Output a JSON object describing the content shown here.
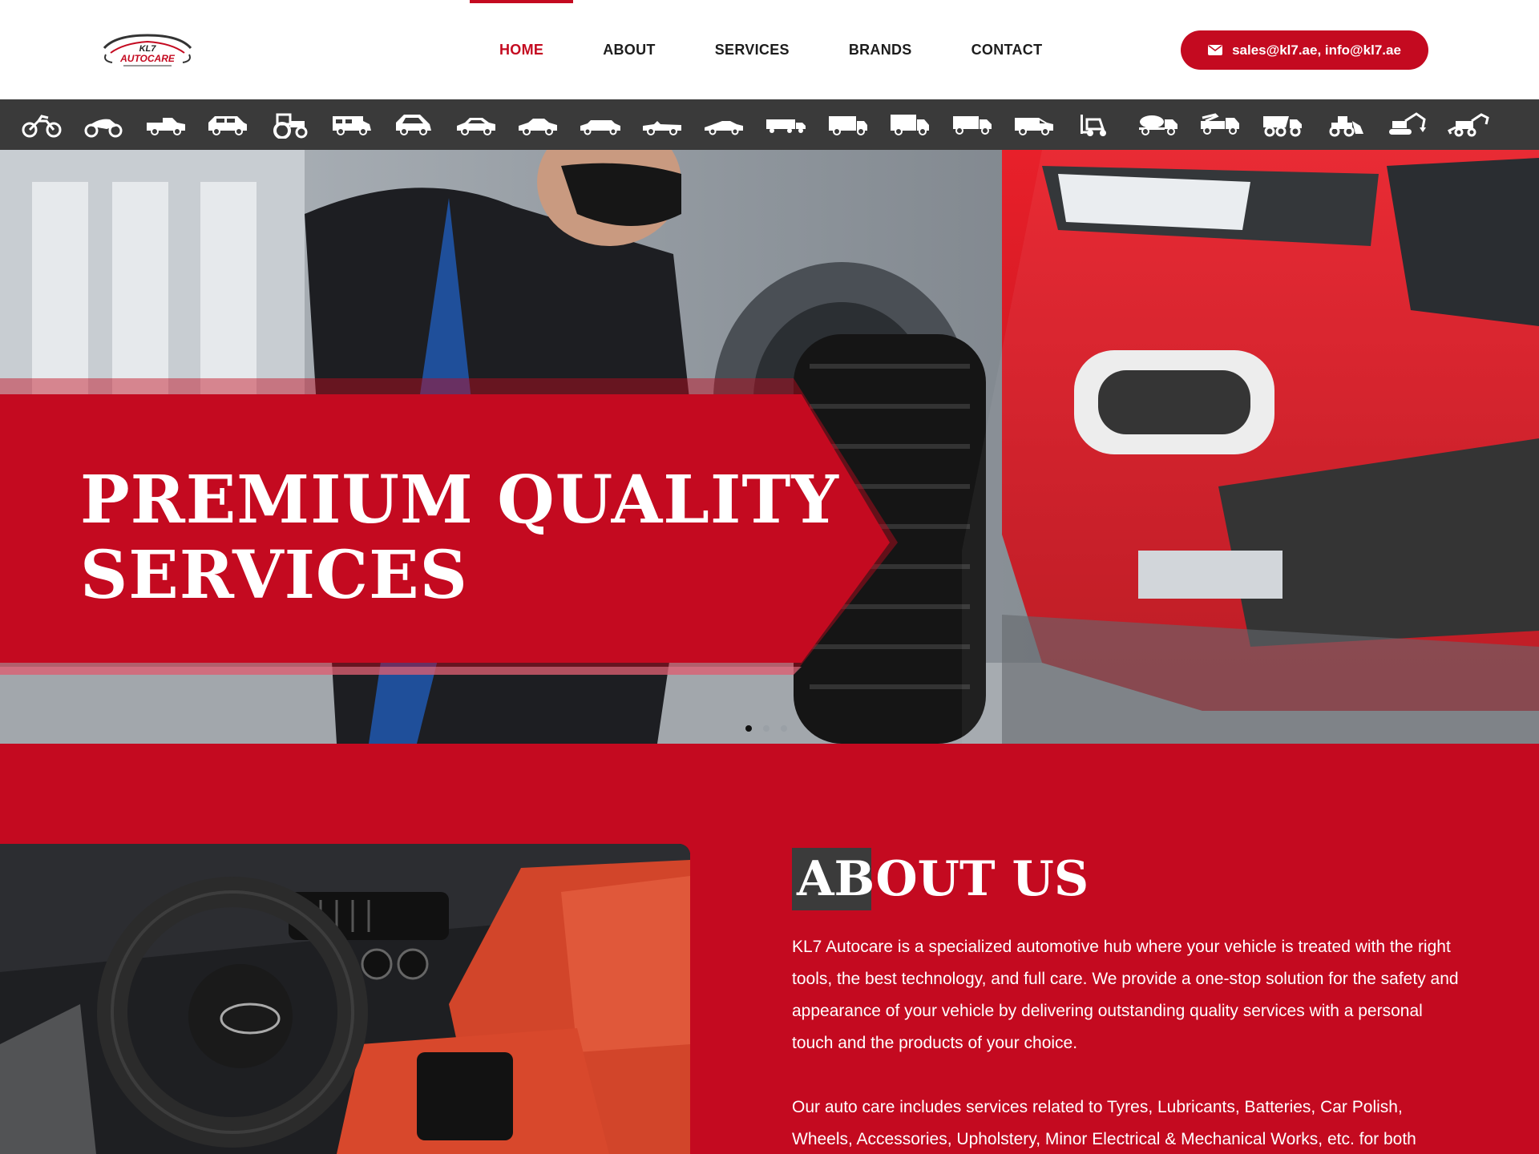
{
  "header": {
    "logo_alt": "KL7 Autocare",
    "logo_top": "KL7",
    "logo_main": "AUTOCARE",
    "nav": [
      {
        "label": "HOME",
        "active": true
      },
      {
        "label": "ABOUT",
        "active": false
      },
      {
        "label": "SERVICES",
        "active": false
      },
      {
        "label": "BRANDS",
        "active": false
      },
      {
        "label": "CONTACT",
        "active": false
      }
    ],
    "email_button": "sales@kl7.ae, info@kl7.ae"
  },
  "vehicle_strip": {
    "icons": [
      "dirt-bike-icon",
      "sport-motorcycle-icon",
      "pickup-truck-icon",
      "suv-icon",
      "tractor-icon",
      "camper-van-icon",
      "hatchback-icon",
      "compact-car-icon",
      "sedan-icon",
      "limousine-icon",
      "convertible-icon",
      "sports-car-icon",
      "semi-trailer-icon",
      "box-truck-icon",
      "delivery-truck-icon",
      "flatbed-truck-icon",
      "van-icon",
      "forklift-icon",
      "cement-mixer-icon",
      "tow-truck-icon",
      "dump-truck-icon",
      "wheel-loader-icon",
      "excavator-icon",
      "backhoe-icon"
    ]
  },
  "hero": {
    "title_line1": "PREMIUM QUALITY",
    "title_line2": "SERVICES",
    "slides": 3,
    "active_slide": 1
  },
  "about": {
    "title": "ABOUT US",
    "paragraph1": "KL7 Autocare is a specialized automotive hub where your vehicle is treated with the right tools, the best technology, and full care. We provide a one-stop solution for the safety and appearance of your vehicle by delivering outstanding quality services with a personal touch and the products of your choice.",
    "paragraph2": "Our auto care includes services related to Tyres, Lubricants, Batteries, Car Polish, Wheels, Accessories, Upholstery, Minor Electrical & Mechanical Works, etc. for both"
  },
  "colors": {
    "brand_red": "#c40a20",
    "dark": "#3a3a3a",
    "white": "#ffffff"
  }
}
